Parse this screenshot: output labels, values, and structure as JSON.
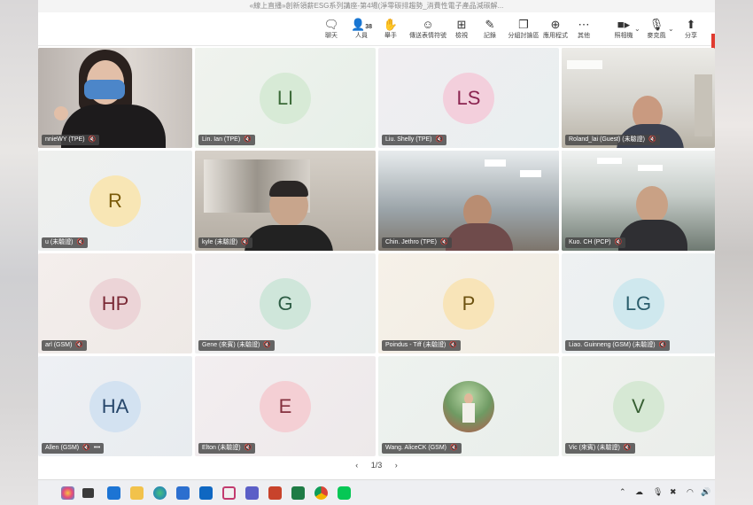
{
  "window": {
    "title": "«線上直播»創新領薪ESG系列講座-第4場(淨零碳排趨勢_消費性電子產品減碳解..."
  },
  "toolbar": {
    "chat": {
      "label": "聊天",
      "icon": "chat-icon"
    },
    "people": {
      "label": "人員",
      "count": "38",
      "icon": "people-icon"
    },
    "raise": {
      "label": "舉手",
      "icon": "hand-icon"
    },
    "reactions": {
      "label": "傳送表情符號",
      "icon": "emoji-icon"
    },
    "view": {
      "label": "檢視",
      "icon": "grid-icon"
    },
    "notes": {
      "label": "記錄",
      "icon": "notes-icon"
    },
    "rooms": {
      "label": "分組討論區",
      "icon": "rooms-icon"
    },
    "apps": {
      "label": "應用程式",
      "icon": "plus-icon"
    },
    "more": {
      "label": "其他",
      "icon": "more-icon"
    },
    "camera": {
      "label": "照相機",
      "icon": "camera-icon"
    },
    "mic": {
      "label": "麥克風",
      "icon": "mic-off-icon"
    },
    "share": {
      "label": "分享",
      "icon": "share-icon"
    }
  },
  "tiles": [
    {
      "name": "nnieWY (TPE)",
      "kind": "video",
      "scene": "woman"
    },
    {
      "name": "Lin. Ian (TPE)",
      "kind": "avatar",
      "initials": "LI",
      "bg": "#d7ead6",
      "fg": "#3b6a38"
    },
    {
      "name": "Liu. Shelly (TPE)",
      "kind": "avatar",
      "initials": "LS",
      "bg": "#f3cfdc",
      "fg": "#8b2450"
    },
    {
      "name": "Roland_lai (Guest) (未驗證)",
      "kind": "video",
      "scene": "office-man"
    },
    {
      "name": "u (未驗證)",
      "kind": "avatar",
      "initials": "R",
      "bg": "#f8e6b5",
      "fg": "#7a5a08"
    },
    {
      "name": "kyle (未驗證)",
      "kind": "video",
      "scene": "kyle"
    },
    {
      "name": "Chin. Jethro (TPE)",
      "kind": "video",
      "scene": "jethro"
    },
    {
      "name": "Kuo. CH (PCP)",
      "kind": "video",
      "scene": "kuo"
    },
    {
      "name": "arl (GSM)",
      "kind": "avatar",
      "initials": "HP",
      "bg": "#ecd4d7",
      "fg": "#7b2a36"
    },
    {
      "name": "Gene (來賓) (未驗證)",
      "kind": "avatar",
      "initials": "G",
      "bg": "#cfe6da",
      "fg": "#2e5d45"
    },
    {
      "name": "Poindus - Tiff (未驗證)",
      "kind": "avatar",
      "initials": "P",
      "bg": "#f8e4b8",
      "fg": "#6d5210"
    },
    {
      "name": "Liao. Guinneng (GSM) (未驗證)",
      "kind": "avatar",
      "initials": "LG",
      "bg": "#cfe8ee",
      "fg": "#2a5d6b"
    },
    {
      "name": "Allen (GSM)",
      "kind": "avatar",
      "initials": "HA",
      "bg": "#d3e2f1",
      "fg": "#27476b",
      "more": "•••"
    },
    {
      "name": "Elton (未驗證)",
      "kind": "avatar",
      "initials": "E",
      "bg": "#f4cfd4",
      "fg": "#84303e"
    },
    {
      "name": "Wang. AliceCK (GSM)",
      "kind": "photo",
      "initials": ""
    },
    {
      "name": "Vic (來賓) (未驗證)",
      "kind": "avatar",
      "initials": "V",
      "bg": "#d6e8d4",
      "fg": "#375f33"
    }
  ],
  "pager": {
    "prev": "‹",
    "page": "1/3",
    "next": "›"
  },
  "taskbar": {
    "icons": [
      "copilot-icon",
      "taskview-icon",
      "widgets-icon",
      "explorer-icon",
      "edge-icon",
      "store-icon",
      "outlook-icon",
      "snip-icon",
      "teams-icon",
      "powerpoint-icon",
      "excel-icon",
      "chrome-icon",
      "line-icon"
    ],
    "tray": [
      "chevron-up-icon",
      "cloud-off-icon",
      "mic-icon",
      "close-circle-icon",
      "wifi-icon",
      "speaker-icon"
    ]
  }
}
